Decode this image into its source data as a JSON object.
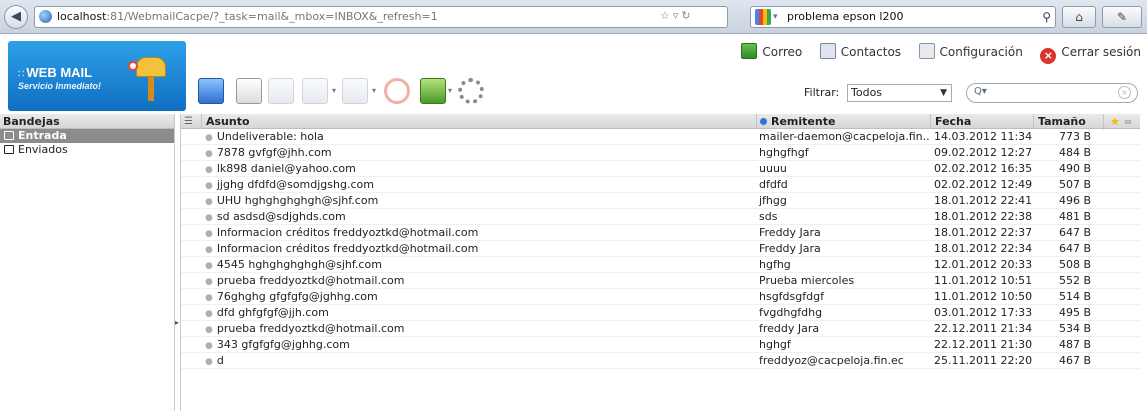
{
  "browser": {
    "url_host": "localhost",
    "url_rest": ":81/WebmailCacpe/?_task=mail&_mbox=INBOX&_refresh=1",
    "search_text": "problema epson l200"
  },
  "logo": {
    "brand": "WEB MAIL",
    "tagline": "Servicio Inmediato!"
  },
  "top_nav": {
    "mail": "Correo",
    "contacts": "Contactos",
    "settings": "Configuración",
    "logout": "Cerrar sesión"
  },
  "toolbar": {
    "icons": [
      "refresh-icon",
      "compose-icon",
      "reply-icon",
      "reply-all-icon",
      "forward-icon",
      "delete-icon",
      "mark-icon",
      "more-actions-icon"
    ]
  },
  "filter": {
    "label": "Filtrar:",
    "selected": "Todos"
  },
  "folders": {
    "header": "Bandejas",
    "items": [
      {
        "label": "Entrada",
        "selected": true
      },
      {
        "label": "Enviados",
        "selected": false
      }
    ]
  },
  "message_list": {
    "columns": {
      "subject": "Asunto",
      "from": "Remitente",
      "date": "Fecha",
      "size": "Tamaño"
    },
    "rows": [
      {
        "subject": "Undeliverable: hola",
        "from": "mailer-daemon@cacpeloja.fin...",
        "date": "14.03.2012 11:34",
        "size": "773 B"
      },
      {
        "subject": "7878 gvfgf@jhh.com",
        "from": "hghgfhgf",
        "date": "09.02.2012 12:27",
        "size": "484 B"
      },
      {
        "subject": "lk898 daniel@yahoo.com",
        "from": "uuuu",
        "date": "02.02.2012 16:35",
        "size": "490 B"
      },
      {
        "subject": "jjghg dfdfd@somdjgshg.com",
        "from": "dfdfd",
        "date": "02.02.2012 12:49",
        "size": "507 B"
      },
      {
        "subject": "UHU hghghghghgh@sjhf.com",
        "from": "jfhgg",
        "date": "18.01.2012 22:41",
        "size": "496 B"
      },
      {
        "subject": "sd asdsd@sdjghds.com",
        "from": "sds",
        "date": "18.01.2012 22:38",
        "size": "481 B"
      },
      {
        "subject": "Informacion créditos freddyoztkd@hotmail.com",
        "from": "Freddy Jara",
        "date": "18.01.2012 22:37",
        "size": "647 B"
      },
      {
        "subject": "Informacion créditos freddyoztkd@hotmail.com",
        "from": "Freddy Jara",
        "date": "18.01.2012 22:34",
        "size": "647 B"
      },
      {
        "subject": "4545 hghghghghgh@sjhf.com",
        "from": "hgfhg",
        "date": "12.01.2012 20:33",
        "size": "508 B"
      },
      {
        "subject": "prueba freddyoztkd@hotmail.com",
        "from": "Prueba miercoles",
        "date": "11.01.2012 10:51",
        "size": "552 B"
      },
      {
        "subject": "76ghghg gfgfgfg@jghhg.com",
        "from": "hsgfdsgfdgf",
        "date": "11.01.2012 10:50",
        "size": "514 B"
      },
      {
        "subject": "dfd ghfgfgf@jjh.com",
        "from": "fvgdhgfdhg",
        "date": "03.01.2012 17:33",
        "size": "495 B"
      },
      {
        "subject": "prueba freddyoztkd@hotmail.com",
        "from": "freddy Jara",
        "date": "22.12.2011 21:34",
        "size": "534 B"
      },
      {
        "subject": "343 gfgfgfg@jghhg.com",
        "from": "hghgf",
        "date": "22.12.2011 21:30",
        "size": "487 B"
      },
      {
        "subject": "d",
        "from": "freddyoz@cacpeloja.fin.ec",
        "date": "25.11.2011 22:20",
        "size": "467 B"
      }
    ]
  }
}
